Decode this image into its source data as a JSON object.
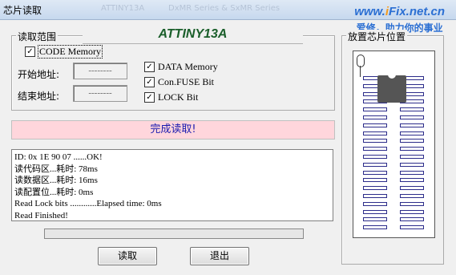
{
  "window": {
    "title": "芯片读取",
    "bg_text_1": "ATTINY13A",
    "bg_text_2": "DxMR Series & SxMR Series"
  },
  "watermark": {
    "url_prefix": "www.",
    "url_accent": "i",
    "url_suffix": "Fix.net.cn",
    "slogan": "爱修，助力你的事业"
  },
  "read_range": {
    "legend": "读取范围",
    "chip_name": "ATTINY13A",
    "code_memory": {
      "label": "CODE Memory",
      "checked": true
    },
    "start_addr": {
      "label": "开始地址:",
      "value": "--------"
    },
    "end_addr": {
      "label": "结束地址:",
      "value": "--------"
    },
    "data_memory": {
      "label": "DATA Memory",
      "checked": true
    },
    "fuse_bit": {
      "label": "Con.FUSE Bit",
      "checked": true
    },
    "lock_bit": {
      "label": "LOCK Bit",
      "checked": true
    }
  },
  "status": {
    "text": "完成读取!",
    "bg_color": "#ffd6dc",
    "text_color": "#1b1bb0"
  },
  "log": [
    "ID: 0x 1E 90 07 ......OK!",
    "读代码区...耗时: 78ms",
    "读数据区...耗时: 16ms",
    "读配置位...耗时: 0ms",
    "Read Lock bits ............Elapsed time: 0ms",
    "Read Finished!"
  ],
  "progress": {
    "value": 0
  },
  "buttons": {
    "read": "读取",
    "exit": "退出"
  },
  "placement": {
    "legend": "放置芯片位置"
  }
}
